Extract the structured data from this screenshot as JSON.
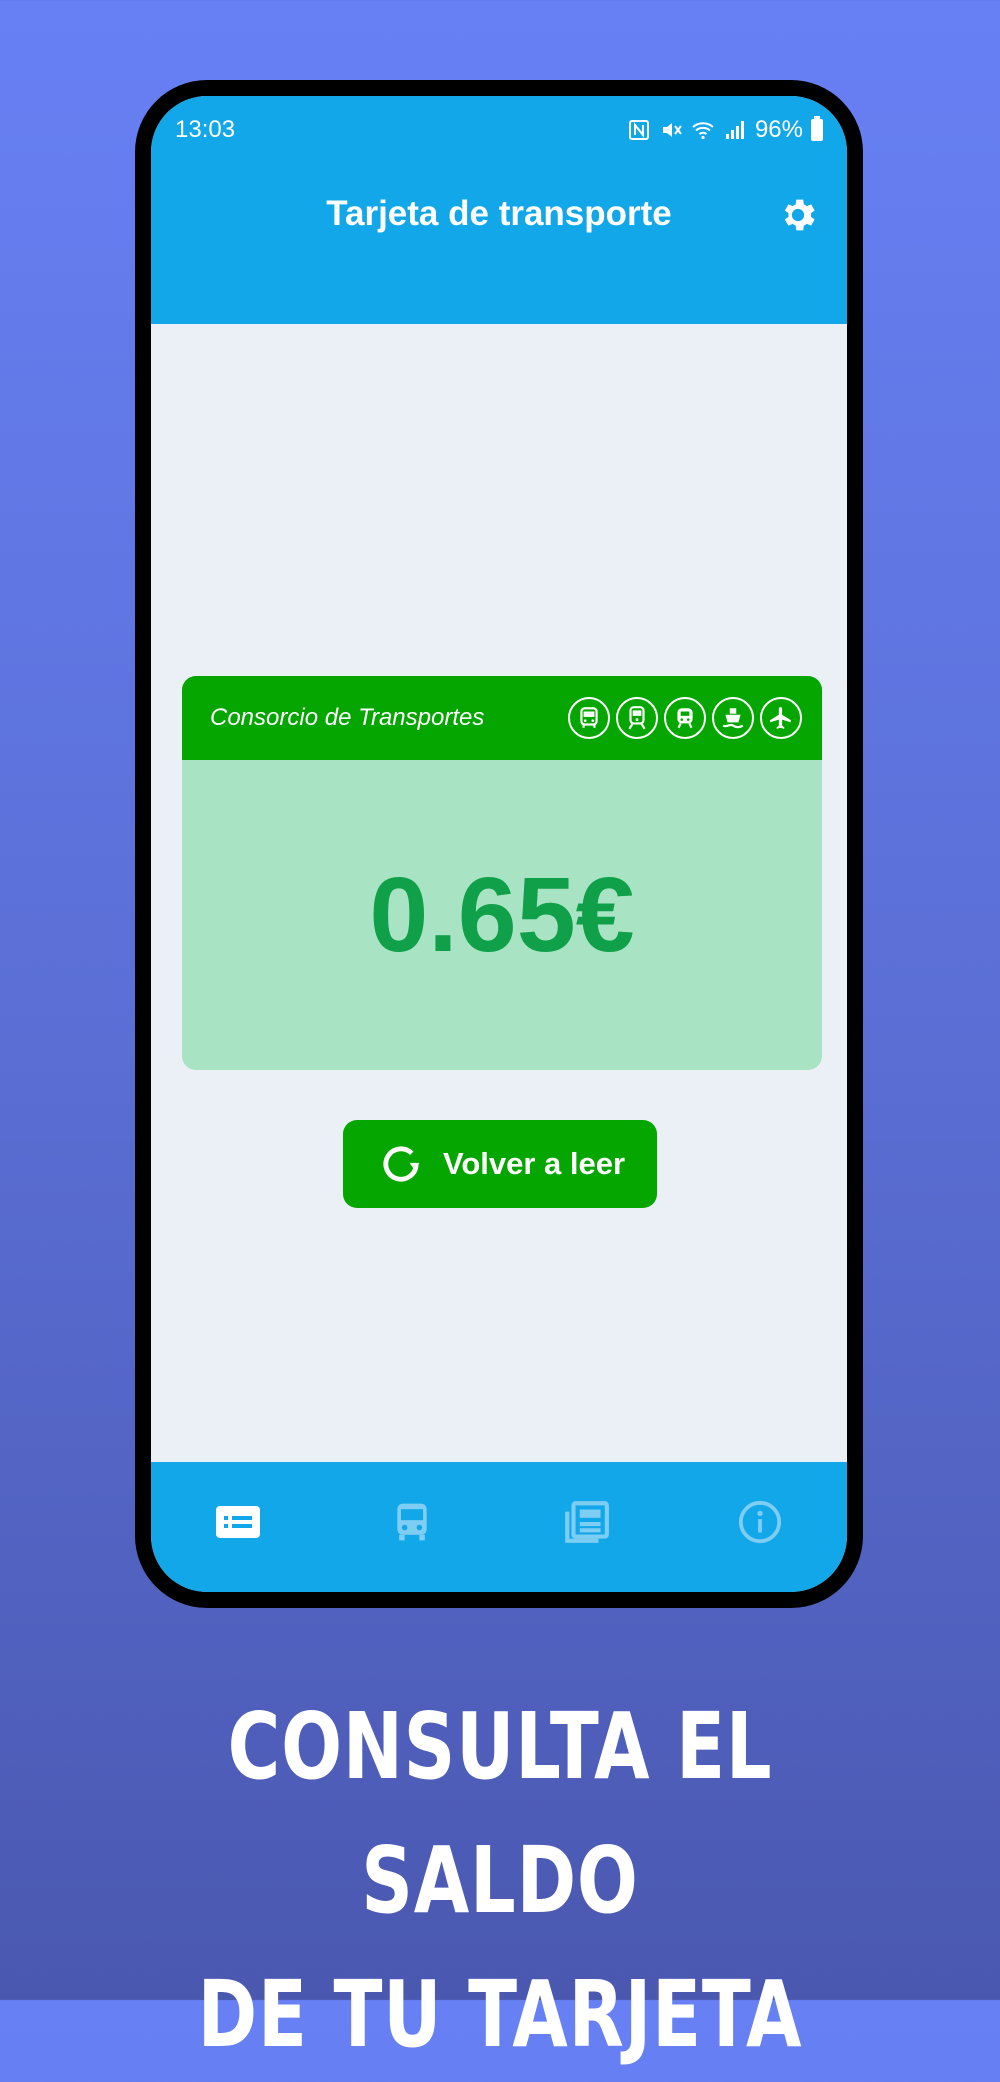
{
  "status": {
    "time": "13:03",
    "battery": "96%"
  },
  "appbar": {
    "title": "Tarjeta de transporte"
  },
  "card": {
    "title": "Consorcio de Transportes",
    "modes": [
      "bus-icon",
      "train-icon",
      "metro-icon",
      "ferry-icon",
      "airplane-icon"
    ],
    "balance": "0.65€"
  },
  "reload": {
    "label": "Volver a leer"
  },
  "nav": {
    "items": [
      "card-icon",
      "bus-icon",
      "news-icon",
      "info-icon"
    ],
    "active": 0
  },
  "promo": {
    "line1": "CONSULTA EL SALDO",
    "line2": "DE TU TARJETA"
  },
  "colors": {
    "primary": "#12a7e8",
    "green": "#05a600",
    "balance_text": "#10a04a",
    "card_bg": "#a8e4c4"
  }
}
